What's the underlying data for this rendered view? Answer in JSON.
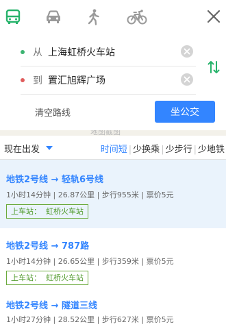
{
  "modes": [
    {
      "name": "bus",
      "icon": "bus-icon",
      "color": "#27b36b"
    },
    {
      "name": "car",
      "icon": "car-icon",
      "color": "#9a9a9a"
    },
    {
      "name": "walk",
      "icon": "walk-icon",
      "color": "#9a9a9a"
    },
    {
      "name": "bike",
      "icon": "bike-icon",
      "color": "#9a9a9a"
    }
  ],
  "route": {
    "from_prefix": "从",
    "from_value": "上海虹桥火车站",
    "to_prefix": "到",
    "to_value": "置汇旭辉广场",
    "clear_label": "清空路线",
    "submit_label": "坐公交"
  },
  "map_peek_text": "地图截图",
  "sort": {
    "depart_label": "现在出发",
    "options": [
      "时间短",
      "少换乘",
      "少步行",
      "少地铁"
    ],
    "active": "时间短"
  },
  "results": [
    {
      "title": "地铁2号线 → 轻轨6号线",
      "meta": "1小时14分钟 | 26.87公里 | 步行955米 | 票价5元",
      "board_label": "上车站：",
      "board_station": "虹桥火车站"
    },
    {
      "title": "地铁2号线 → 787路",
      "meta": "1小时14分钟 | 26.65公里 | 步行359米 | 票价5元",
      "board_label": "上车站：",
      "board_station": "虹桥火车站"
    },
    {
      "title": "地铁2号线 → 隧道三线",
      "meta": "1小时27分钟 | 28.52公里 | 步行627米 | 票价5元"
    }
  ],
  "colors": {
    "accent": "#3385ff",
    "board": "#6aaa3c",
    "selected_bg": "#eaf3fc"
  }
}
